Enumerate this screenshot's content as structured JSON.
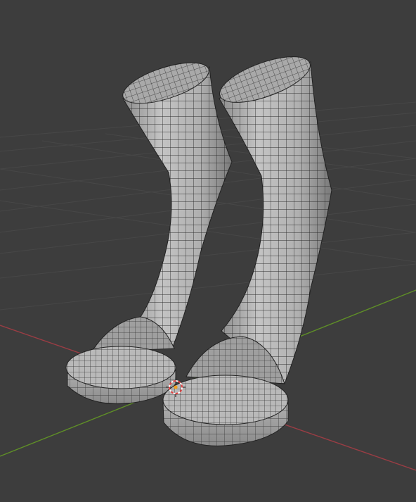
{
  "viewport": {
    "background": "#3d3d3d",
    "grid_color": "#4a4a4a",
    "x_axis_color": "#a8444a",
    "y_axis_color": "#6b9a2d"
  },
  "scene": {
    "objects": [
      {
        "name": "left-sock-mesh",
        "mode": "wireframe-over-solid",
        "surface_color": "#b8b8b8",
        "wire_color": "#1a1a1a"
      },
      {
        "name": "right-sock-mesh",
        "mode": "wireframe-over-solid",
        "surface_color": "#b8b8b8",
        "wire_color": "#1a1a1a"
      }
    ],
    "cursor": {
      "icon": "3d-cursor-icon",
      "ring_colors": [
        "#e04040",
        "#ffffff"
      ],
      "origin_color": "#f0a020"
    }
  }
}
